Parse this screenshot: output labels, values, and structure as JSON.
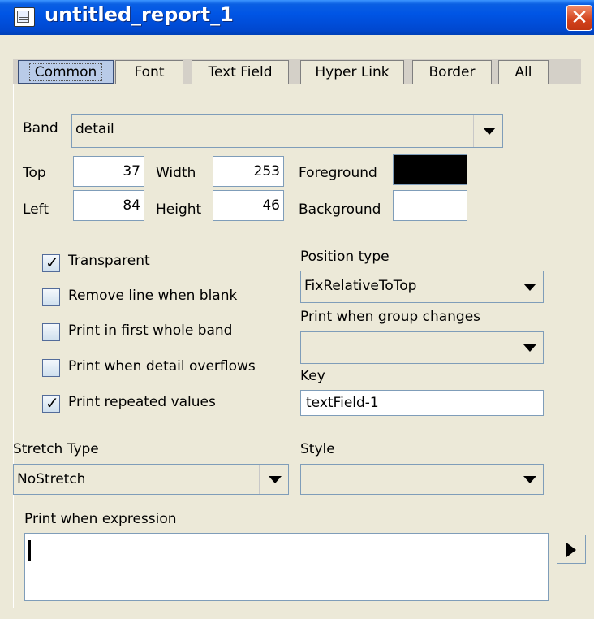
{
  "window": {
    "title": "untitled_report_1",
    "close_glyph": "✕",
    "title_icon": "report-icon"
  },
  "tabs": [
    {
      "label": "Common",
      "active": true
    },
    {
      "label": "Font",
      "active": false
    },
    {
      "label": "Text Field",
      "active": false
    },
    {
      "label": "Hyper Link",
      "active": false
    },
    {
      "label": "Border",
      "active": false
    },
    {
      "label": "All",
      "active": false
    }
  ],
  "band": {
    "label": "Band",
    "value": "detail"
  },
  "geometry": {
    "top_label": "Top",
    "top_value": "37",
    "width_label": "Width",
    "width_value": "253",
    "left_label": "Left",
    "left_value": "84",
    "height_label": "Height",
    "height_value": "46"
  },
  "colors": {
    "foreground_label": "Foreground",
    "foreground": "#000000",
    "background_label": "Background",
    "background": "#ffffff"
  },
  "checkboxes": [
    {
      "label": "Transparent",
      "checked": true
    },
    {
      "label": "Remove line when blank",
      "checked": false
    },
    {
      "label": "Print in first whole band",
      "checked": false
    },
    {
      "label": "Print when detail overflows",
      "checked": false
    },
    {
      "label": "Print repeated values",
      "checked": true
    }
  ],
  "position_type": {
    "label": "Position type",
    "value": "FixRelativeToTop"
  },
  "print_when_group": {
    "label": "Print when group changes",
    "value": ""
  },
  "key": {
    "label": "Key",
    "value": "textField-1"
  },
  "stretch_type": {
    "label": "Stretch Type",
    "value": "NoStretch"
  },
  "style": {
    "label": "Style",
    "value": ""
  },
  "print_when_expression": {
    "label": "Print when expression",
    "value": ""
  }
}
